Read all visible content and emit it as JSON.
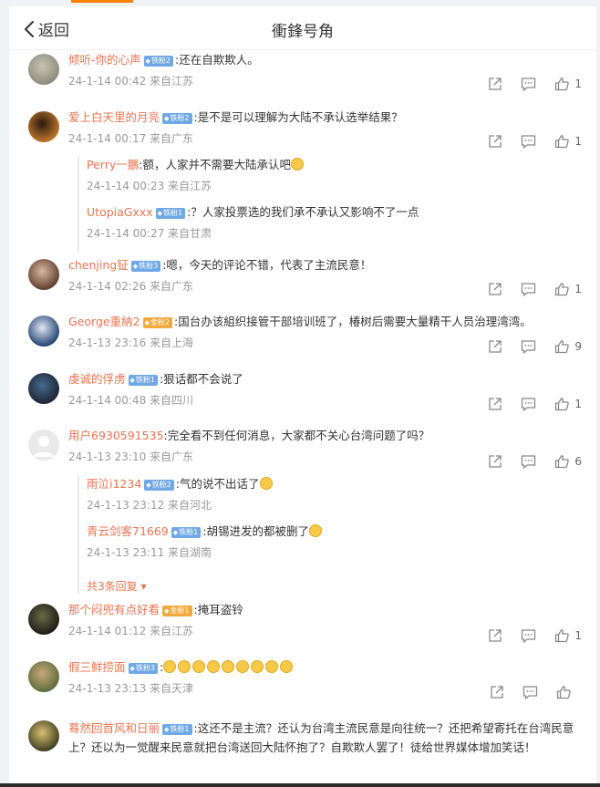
{
  "header": {
    "back_label": "返回",
    "title": "衝鋒号角"
  },
  "comments": [
    {
      "user": "倾听-你的心声",
      "badge": "铁粉2",
      "badge_color": "blue",
      "text": ":还在自欺欺人。",
      "time": "24-1-14 00:42 来自江苏",
      "likes": "1",
      "avatar_colors": [
        "#8a8a7a",
        "#c9c2b5"
      ]
    },
    {
      "user": "爱上白天里的月亮",
      "badge": "铁粉2",
      "badge_color": "blue",
      "text": ":是不是可以理解为大陆不承认选举结果？",
      "time": "24-1-14 00:17 来自广东",
      "likes": "1",
      "avatar_colors": [
        "#c47a2c",
        "#2a1a10"
      ],
      "replies": [
        {
          "user": "Perry一鵬",
          "badge": "",
          "text": ":额，人家并不需要大陆承认吧",
          "emoji_count": 1,
          "time": "24-1-14 00:23 来自江苏"
        },
        {
          "user": "UtopiaGxxx",
          "badge": "铁粉1",
          "text": ":？人家投票选的我们承不承认又影响不了一点",
          "emoji_count": 0,
          "time": "24-1-14 00:27 来自甘肃"
        }
      ]
    },
    {
      "user": "chenjing钲",
      "badge": "铁粉3",
      "badge_color": "blue",
      "text": ":嗯，今天的评论不错，代表了主流民意！",
      "time": "24-1-14 02:26 来自广东",
      "likes": "1",
      "avatar_colors": [
        "#5b3a2a",
        "#d9b8a0"
      ]
    },
    {
      "user": "George重納2",
      "badge": "金粉2",
      "badge_color": "gold",
      "text": ":国台办该組织接管干部培训班了，椿树后需要大量精干人员治理湾湾。",
      "time": "24-1-13 23:16 来自上海",
      "likes": "9",
      "avatar_colors": [
        "#1d3d6e",
        "#dfe8f2"
      ]
    },
    {
      "user": "虔诚的俘虏",
      "badge": "铁粉1",
      "badge_color": "blue",
      "text": ":狠话都不会说了",
      "time": "24-1-14 00:48 来自四川",
      "likes": "1",
      "avatar_colors": [
        "#1a2233",
        "#4a6a8a"
      ]
    },
    {
      "user": "用户6930591535",
      "badge": "",
      "badge_color": "",
      "text": ":完全看不到任何消息，大家都不关心台湾问题了吗？",
      "time": "24-1-13 23:10 来自广东",
      "likes": "6",
      "avatar_colors": [
        "#e6e6e6",
        "#ffffff"
      ],
      "replies": [
        {
          "user": "雨泣i1234",
          "badge": "铁粉2",
          "text": ":气的说不出话了",
          "emoji_count": 1,
          "time": "24-1-13 23:12 来自河北"
        },
        {
          "user": "青云剑客71669",
          "badge": "铁粉1",
          "text": ":胡锡进发的都被删了",
          "emoji_count": 1,
          "time": "24-1-13 23:11 来自湖南"
        }
      ],
      "more": "共3条回复"
    },
    {
      "user": "那个闷兜有点好看",
      "badge": "金粉1",
      "badge_color": "gold",
      "text": ":掩耳盗铃",
      "time": "24-1-14 01:12 来自江苏",
      "likes": "1",
      "avatar_colors": [
        "#1a1a14",
        "#6b6a4a"
      ]
    },
    {
      "user": "假三鲜捞面",
      "badge": "铁粉3",
      "badge_color": "blue",
      "text": ":",
      "emoji_count": 9,
      "time": "24-1-13 23:13 来自天津",
      "likes": "",
      "avatar_colors": [
        "#5a6a3a",
        "#c9a87a"
      ]
    },
    {
      "user": "蓦然回首风和日丽",
      "badge": "铁粉1",
      "badge_color": "blue",
      "text": ":这还不是主流？还认为台湾主流民意是向往统一？还把希望寄托在台湾民意上？还以为一觉醒来民意就把台湾送回大陆怀抱了？自欺欺人罢了！徒给世界媒体增加笑话！",
      "time": "",
      "likes": "",
      "avatar_colors": [
        "#3a3a20",
        "#d9c070"
      ]
    }
  ],
  "icons": {
    "back": "chevron-left-icon",
    "share": "share-icon",
    "comment": "comment-icon",
    "like": "thumbs-up-icon"
  },
  "colors": {
    "accent": "#ff8200",
    "username": "#eb7350",
    "badge_blue": "#6fa8e4",
    "badge_gold": "#f2a93b",
    "meta": "#999999"
  }
}
